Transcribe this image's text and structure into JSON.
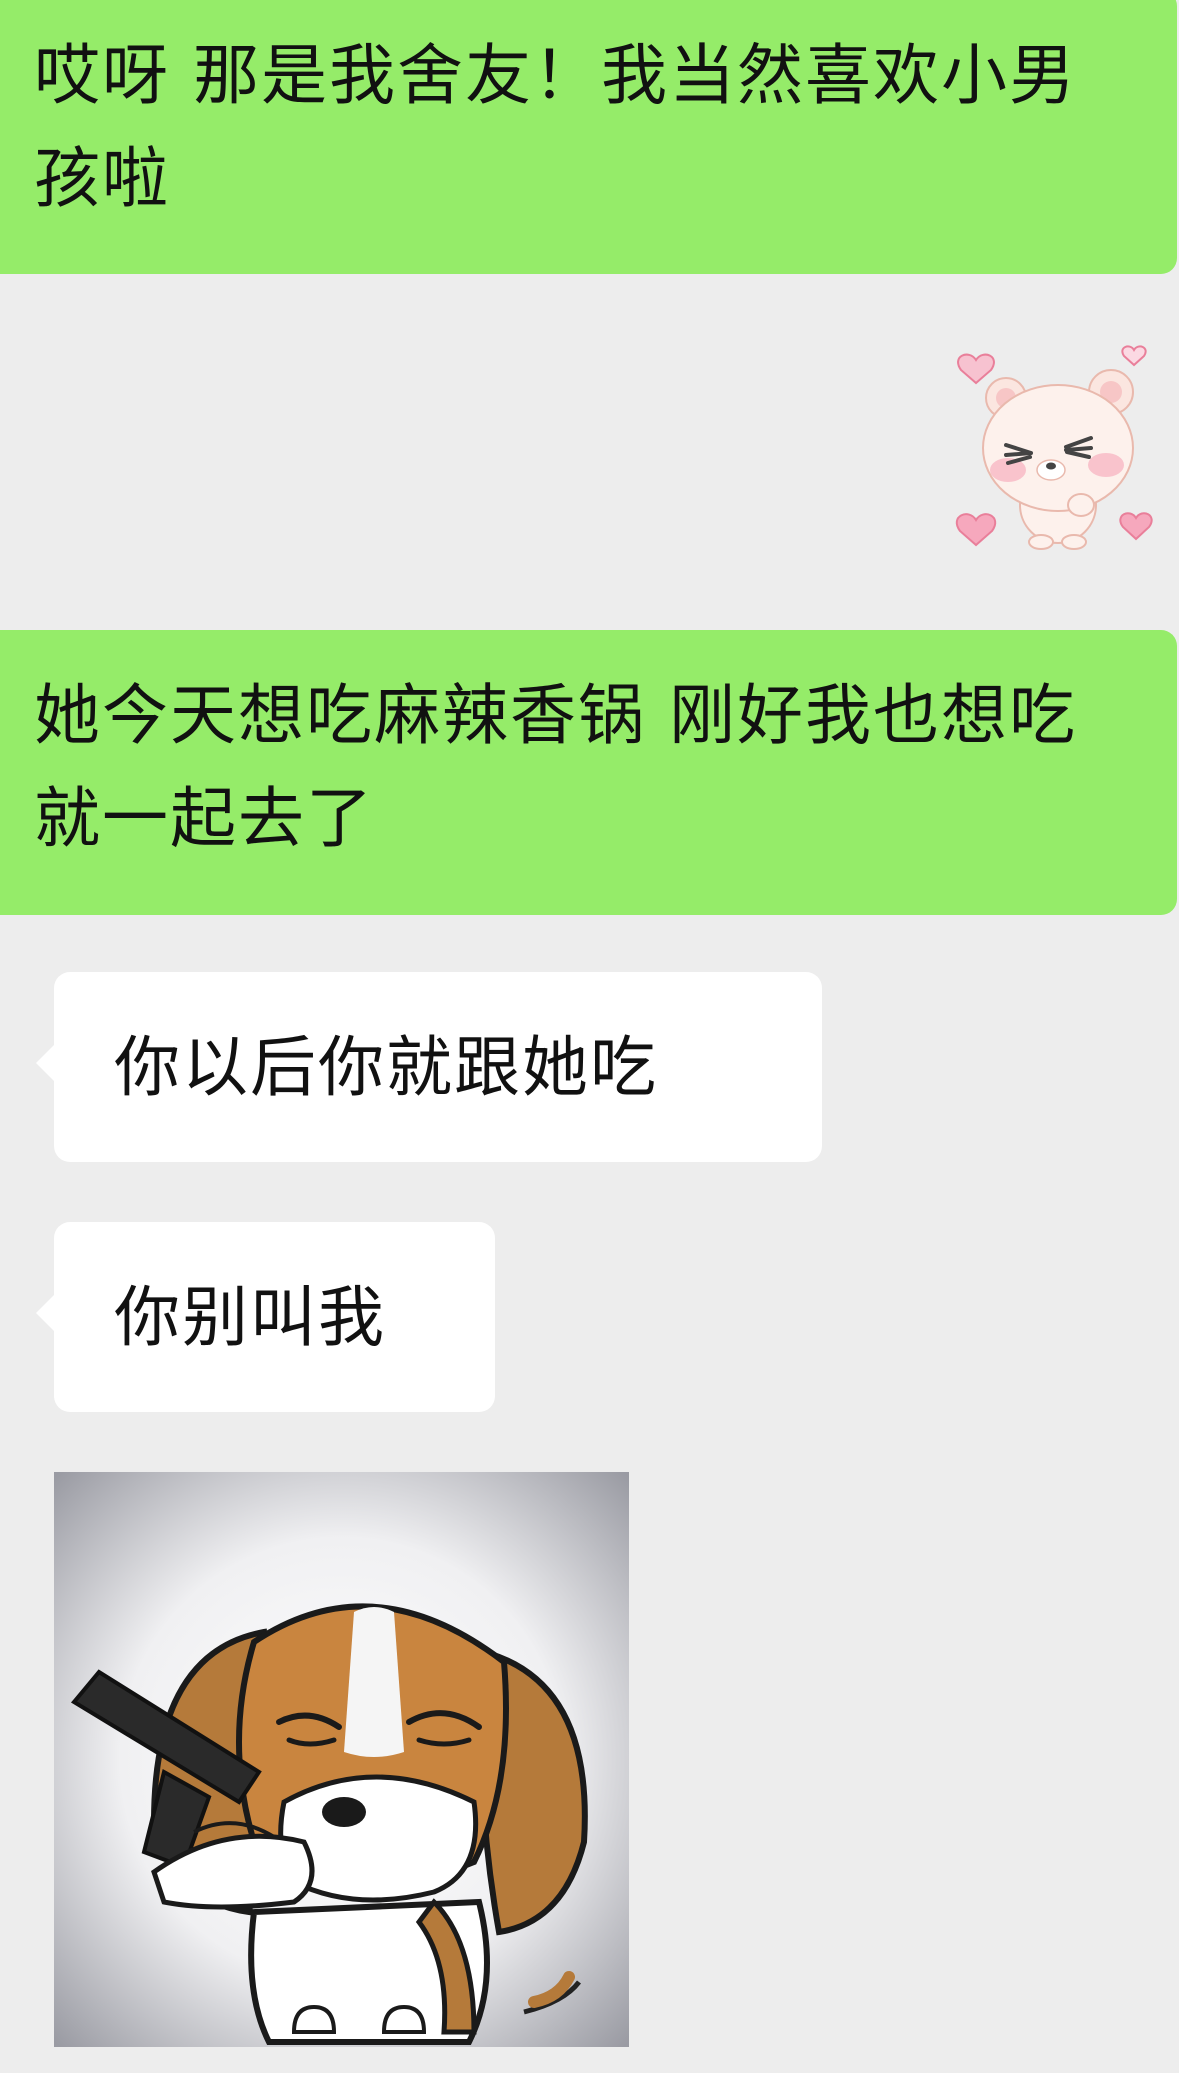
{
  "messages": [
    {
      "id": "m1",
      "from": "self",
      "type": "text",
      "text": "哎呀 那是我舍友！我当然喜欢小男孩啦"
    },
    {
      "id": "m2",
      "from": "self",
      "type": "sticker",
      "sticker": "blushing-bear-hearts-sticker"
    },
    {
      "id": "m3",
      "from": "self",
      "type": "text",
      "text": "她今天想吃麻辣香锅 刚好我也想吃 就一起去了"
    },
    {
      "id": "m4",
      "from": "other",
      "type": "text",
      "text": "你以后你就跟她吃"
    },
    {
      "id": "m5",
      "from": "other",
      "type": "text",
      "text": "你别叫我"
    },
    {
      "id": "m6",
      "from": "other",
      "type": "sticker",
      "sticker": "beagle-with-gun-sticker"
    }
  ],
  "colors": {
    "background": "#ededed",
    "sent_bubble": "#95ec69",
    "received_bubble": "#ffffff",
    "text": "#111111"
  }
}
